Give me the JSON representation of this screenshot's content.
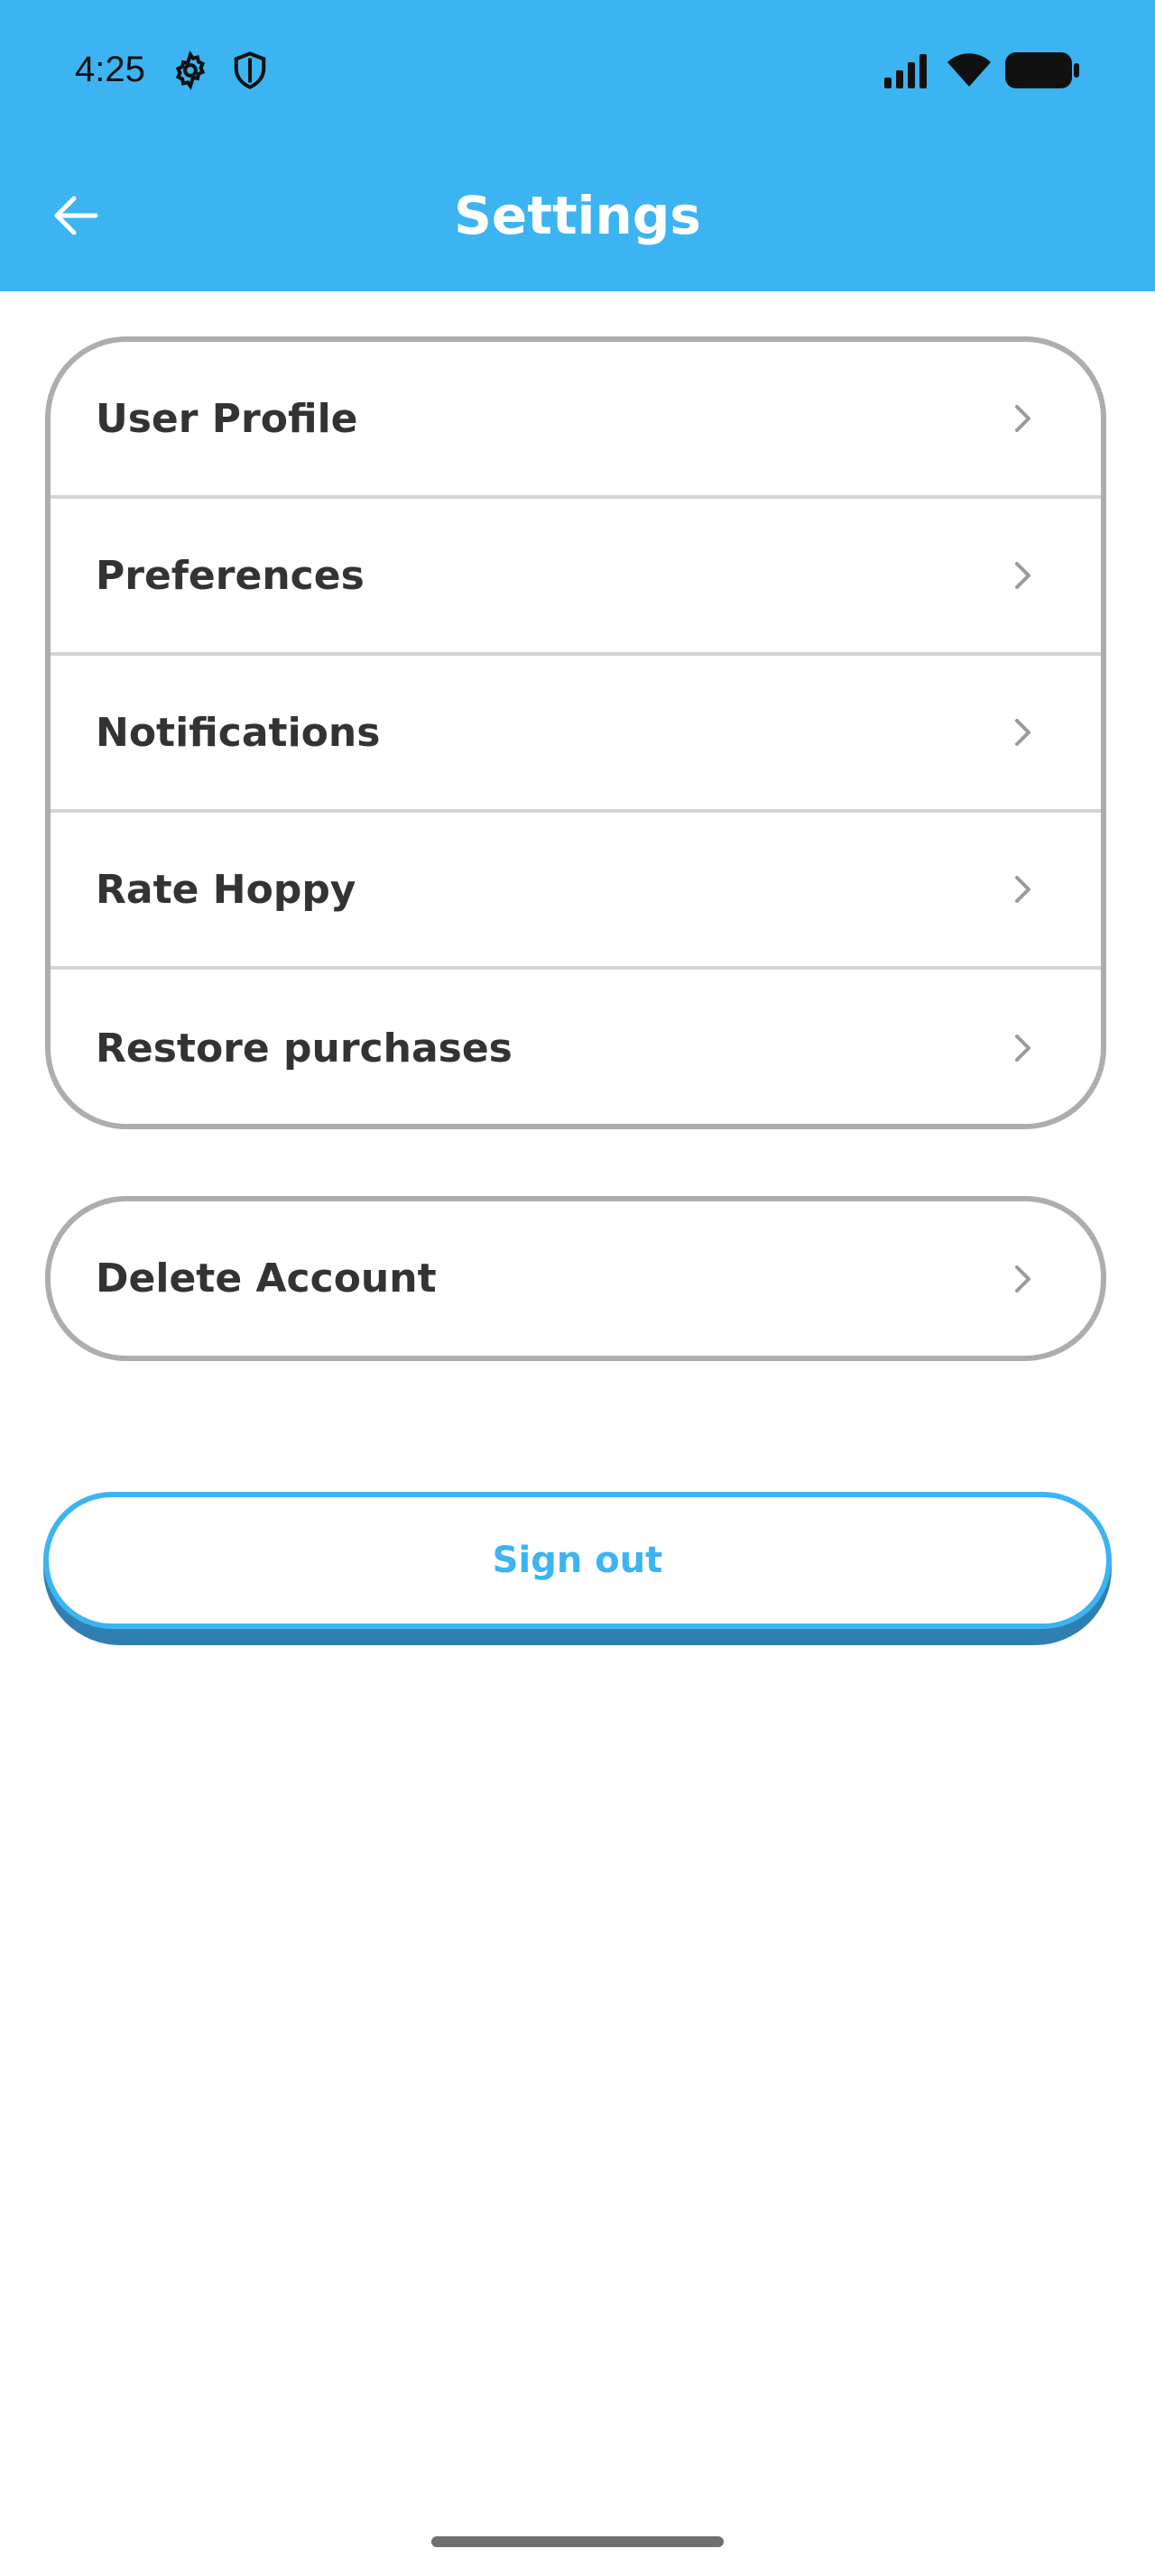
{
  "status_bar": {
    "time": "4:25",
    "left_icons": [
      "gear-icon",
      "shield-icon"
    ],
    "right_icons": [
      "signal-icon",
      "wifi-icon",
      "battery-icon"
    ]
  },
  "app_bar": {
    "title": "Settings",
    "back_icon": "arrow-left-icon"
  },
  "settings_group": {
    "items": [
      {
        "label": "User Profile",
        "icon": "chevron-right-icon"
      },
      {
        "label": "Preferences",
        "icon": "chevron-right-icon"
      },
      {
        "label": "Notifications",
        "icon": "chevron-right-icon"
      },
      {
        "label": "Rate Hoppy",
        "icon": "chevron-right-icon"
      },
      {
        "label": "Restore purchases",
        "icon": "chevron-right-icon"
      }
    ]
  },
  "account_group": {
    "delete_label": "Delete Account"
  },
  "sign_out": {
    "label": "Sign out"
  },
  "colors": {
    "accent": "#3cb4f2",
    "accent_shadow": "#2f7fb1",
    "card_border": "#adadad",
    "divider": "#d4d4d4",
    "text": "#333333"
  }
}
